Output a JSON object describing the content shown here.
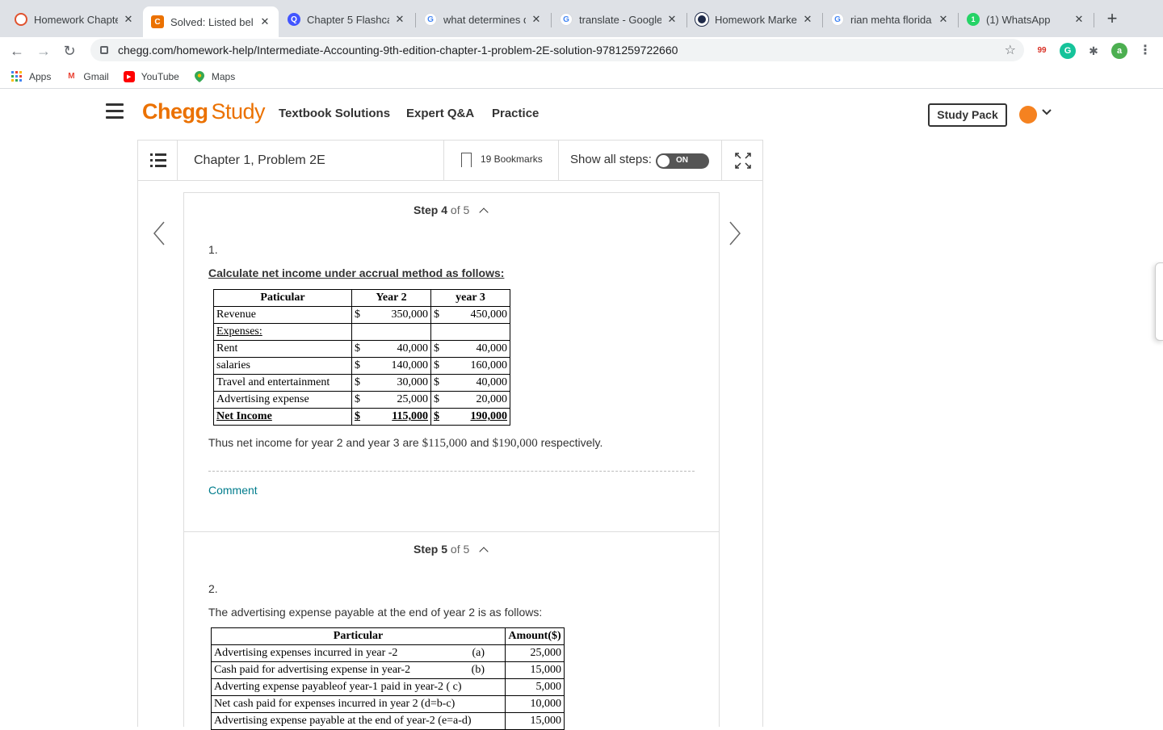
{
  "browser": {
    "tabs": [
      {
        "title": "Homework Chapte",
        "icon": "homework-icon"
      },
      {
        "title": "Solved: Listed bel",
        "icon": "chegg-icon",
        "active": true
      },
      {
        "title": "Chapter 5 Flashca",
        "icon": "quizlet-icon"
      },
      {
        "title": "what determines d",
        "icon": "google-icon"
      },
      {
        "title": "translate - Google",
        "icon": "google-icon"
      },
      {
        "title": "Homework Market",
        "icon": "homework-market-icon"
      },
      {
        "title": "rian mehta florida",
        "icon": "google-icon"
      },
      {
        "title": "(1) WhatsApp",
        "icon": "whatsapp-icon",
        "badge": "1"
      }
    ],
    "url": "chegg.com/homework-help/Intermediate-Accounting-9th-edition-chapter-1-problem-2E-solution-9781259722660",
    "bookmarks": [
      "Apps",
      "Gmail",
      "YouTube",
      "Maps"
    ],
    "profile_initial": "a"
  },
  "header": {
    "logo_brand": "Chegg",
    "logo_product": "Study",
    "nav": [
      "Textbook Solutions",
      "Expert Q&A",
      "Practice"
    ],
    "study_pack": "Study Pack"
  },
  "problem_bar": {
    "title": "Chapter 1, Problem 2E",
    "bookmarks": "19 Bookmarks",
    "show_steps_label": "Show all steps:",
    "toggle_label": "ON"
  },
  "step4": {
    "step_label": "Step 4",
    "of_label": "of 5",
    "number": "1.",
    "heading": "Calculate net income under accrual method as follows:",
    "table": {
      "headers": [
        "Paticular",
        "Year 2",
        "year 3"
      ],
      "rows": [
        {
          "label": "Revenue",
          "y2": "350,000",
          "y3": "450,000",
          "sym": "$"
        },
        {
          "label": "Expenses:",
          "y2": "",
          "y3": "",
          "sym": ""
        },
        {
          "label": "Rent",
          "y2": "40,000",
          "y3": "40,000",
          "sym": "$"
        },
        {
          "label": "salaries",
          "y2": "140,000",
          "y3": "160,000",
          "sym": "$"
        },
        {
          "label": "Travel and entertainment",
          "y2": "30,000",
          "y3": "40,000",
          "sym": "$"
        },
        {
          "label": "Advertising expense",
          "y2": "25,000",
          "y3": "20,000",
          "sym": "$"
        },
        {
          "label": "Net Income",
          "y2": "115,000",
          "y3": "190,000",
          "sym": "$"
        }
      ]
    },
    "conclusion_pre": "Thus net income for year 2 and year 3 are",
    "conclusion_v1": "$115,000",
    "conclusion_and": "and",
    "conclusion_v2": "$190,000",
    "conclusion_post": "respectively.",
    "comment": "Comment"
  },
  "step5": {
    "step_label": "Step 5",
    "of_label": "of 5",
    "number": "2.",
    "heading": "The advertising expense payable at the end of year 2 is as follows:",
    "table": {
      "headers": [
        "Particular",
        "Amount($)"
      ],
      "rows": [
        {
          "label": "Advertising expenses incurred in year -2",
          "tag": "(a)",
          "amount": "25,000"
        },
        {
          "label": "Cash paid for advertising expense in year-2",
          "tag": "(b)",
          "amount": "15,000"
        },
        {
          "label": "Adverting expense payableof year-1 paid in year-2 ( c)",
          "tag": "",
          "amount": "5,000"
        },
        {
          "label": "Net cash paid for expenses incurred in year 2  (d=b-c)",
          "tag": "",
          "amount": "10,000"
        },
        {
          "label": "Advertising expense payable at the end of year-2 (e=a-d)",
          "tag": "",
          "amount": "15,000"
        }
      ]
    }
  }
}
